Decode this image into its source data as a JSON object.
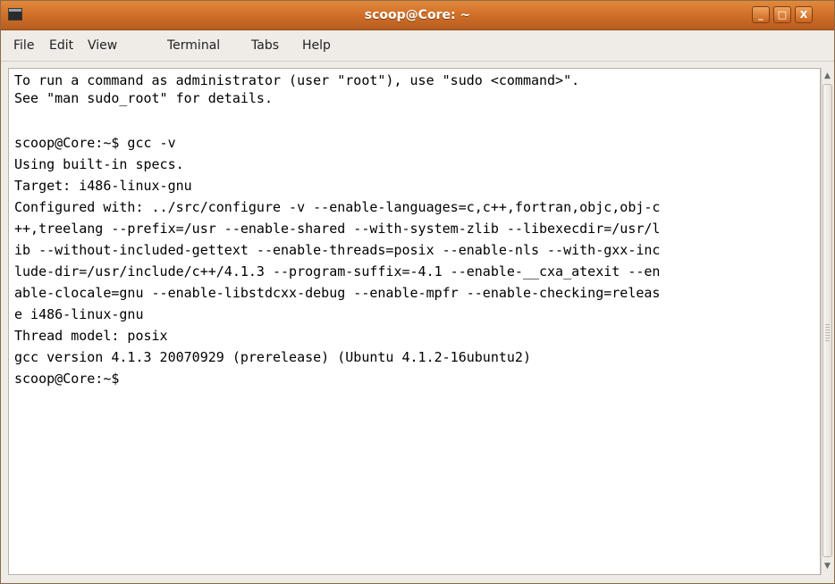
{
  "window": {
    "title": "scoop@Core: ~"
  },
  "titlebar_buttons": {
    "minimize": "_",
    "maximize": "□",
    "close": "X"
  },
  "menu": [
    {
      "label": "File"
    },
    {
      "label": "Edit"
    },
    {
      "label": "View"
    },
    {
      "label": "Terminal"
    },
    {
      "label": "Tabs"
    },
    {
      "label": "Help"
    }
  ],
  "terminal": {
    "lines": [
      "To run a command as administrator (user \"root\"), use \"sudo <command>\".",
      "See \"man sudo_root\" for details.",
      "",
      "scoop@Core:~$ gcc -v",
      "Using built-in specs.",
      "Target: i486-linux-gnu",
      "Configured with: ../src/configure -v --enable-languages=c,c++,fortran,objc,obj-c",
      "++,treelang --prefix=/usr --enable-shared --with-system-zlib --libexecdir=/usr/l",
      "ib --without-included-gettext --enable-threads=posix --enable-nls --with-gxx-inc",
      "lude-dir=/usr/include/c++/4.1.3 --program-suffix=-4.1 --enable-__cxa_atexit --en",
      "able-clocale=gnu --enable-libstdcxx-debug --enable-mpfr --enable-checking=releas",
      "e i486-linux-gnu",
      "Thread model: posix",
      "gcc version 4.1.3 20070929 (prerelease) (Ubuntu 4.1.2-16ubuntu2)",
      "scoop@Core:~$"
    ]
  }
}
